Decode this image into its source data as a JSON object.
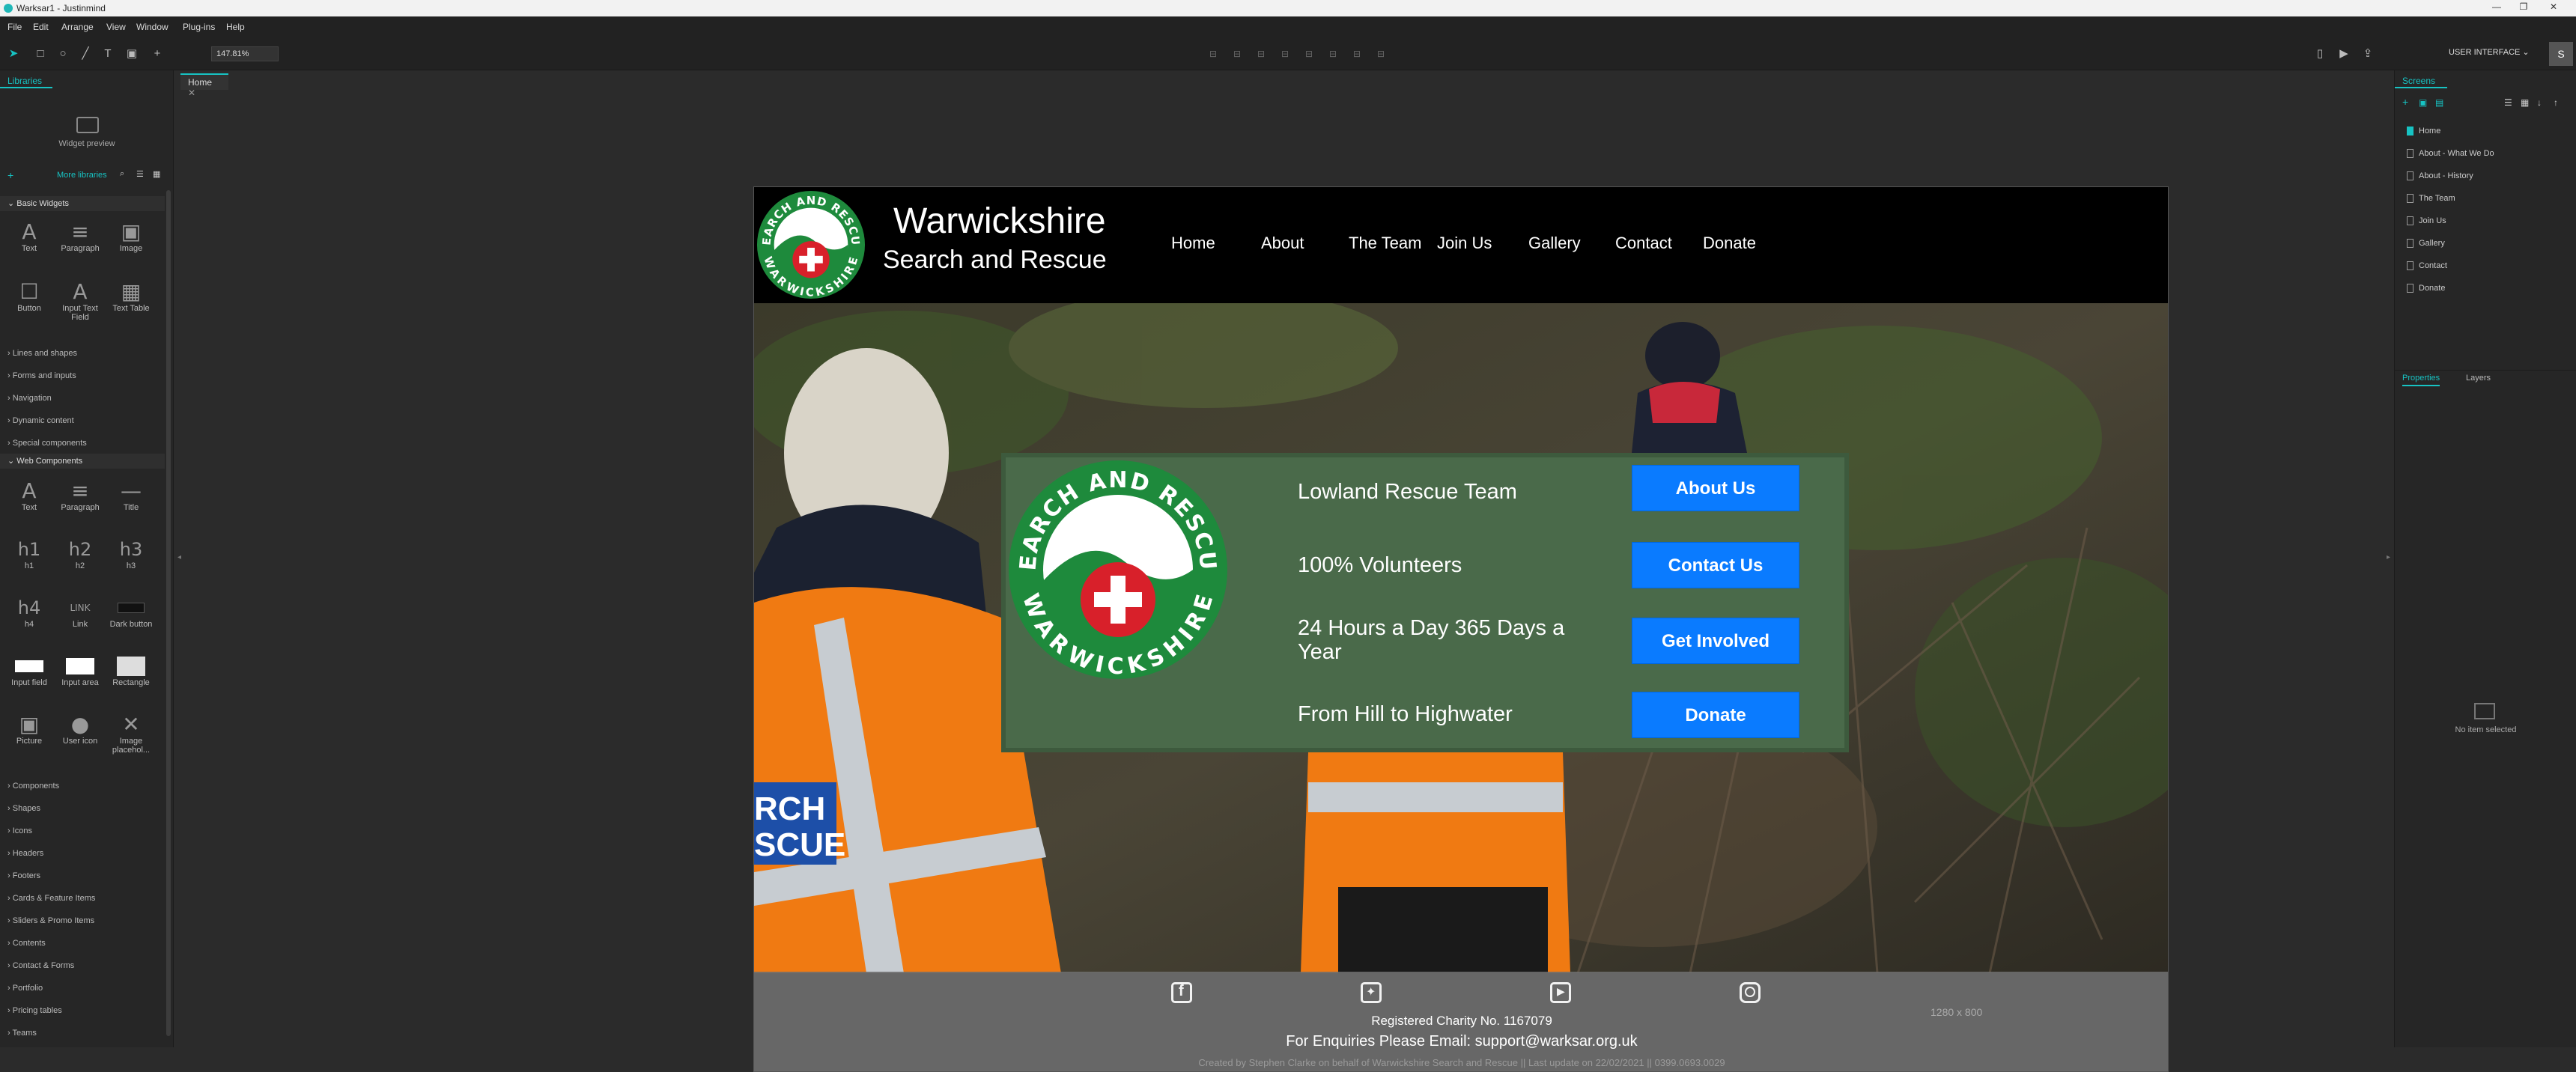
{
  "window": {
    "title": "Warksar1 - Justinmind"
  },
  "menu": [
    "File",
    "Edit",
    "Arrange",
    "View",
    "Window",
    "Plug-ins",
    "Help"
  ],
  "toolbar": {
    "zoom": "147.81%",
    "ui_mode": "USER INTERFACE",
    "avatar": "S"
  },
  "left_panel": {
    "tab": "Libraries",
    "widget_preview": "Widget preview",
    "more_libraries": "More libraries",
    "basic_header": "Basic Widgets",
    "basic_widgets": [
      "Text",
      "Paragraph",
      "Image",
      "Button",
      "Input Text Field",
      "Text Table"
    ],
    "basic_glyphs": [
      "A",
      "≡",
      "▣",
      "☐",
      "A",
      "▦"
    ],
    "categories_a": [
      "Lines and shapes",
      "Forms and inputs",
      "Navigation",
      "Dynamic content",
      "Special components"
    ],
    "web_header": "Web Components",
    "web_widgets": [
      "Text",
      "Paragraph",
      "Title",
      "h1",
      "h2",
      "h3",
      "h4",
      "Link",
      "Dark button",
      "Input field",
      "Input area",
      "Rectangle",
      "Picture",
      "User icon",
      "Image placehol..."
    ],
    "web_glyphs": [
      "A",
      "≡",
      "—",
      "h1",
      "h2",
      "h3",
      "h4",
      "LINK",
      "",
      "",
      "",
      "",
      "▣",
      "●",
      "✕"
    ],
    "categories_b": [
      "Components",
      "Shapes",
      "Icons",
      "Headers",
      "Footers",
      "Cards & Feature Items",
      "Sliders & Promo Items",
      "Contents",
      "Contact & Forms",
      "Portfolio",
      "Pricing tables",
      "Teams"
    ]
  },
  "canvas": {
    "tab": "Home",
    "size_label": "1280 x 800"
  },
  "site": {
    "title": "Warwickshire",
    "subtitle": "Search and Rescue",
    "logo_top_text": "SEARCH AND RESCUE",
    "logo_bottom_text": "WARWICKSHIRE",
    "nav": [
      "Home",
      "About",
      "The Team",
      "Join Us",
      "Gallery",
      "Contact",
      "Donate"
    ],
    "info_lines": [
      "Lowland Rescue Team",
      "100% Volunteers",
      "24 Hours a Day 365 Days a Year",
      "From Hill to Highwater"
    ],
    "buttons": [
      "About Us",
      "Contact Us",
      "Get Involved",
      "Donate"
    ],
    "jacket_text": [
      "RCH",
      "SCUE"
    ],
    "social_icons": [
      "facebook-icon",
      "twitter-icon",
      "youtube-icon",
      "instagram-icon"
    ],
    "charity": "Registered Charity No. 1167079",
    "enquiries": "For Enquiries Please Email: support@warksar.org.uk",
    "credit": "Created by Stephen Clarke on behalf of Warwickshire Search and Rescue || Last update on 22/02/2021 || 0399.0693.0029"
  },
  "right_panel": {
    "tab": "Screens",
    "screens": [
      "Home",
      "About - What We Do",
      "About - History",
      "The Team",
      "Join Us",
      "Gallery",
      "Contact",
      "Donate"
    ],
    "properties_tab": "Properties",
    "layers_tab": "Layers",
    "no_item": "No item selected"
  },
  "colors": {
    "accent": "#17c3c3",
    "button_blue": "#0a7bff",
    "info_green": "#4a6a4a",
    "logo_green": "#1e8a3c",
    "red_cross": "#d8202a"
  }
}
